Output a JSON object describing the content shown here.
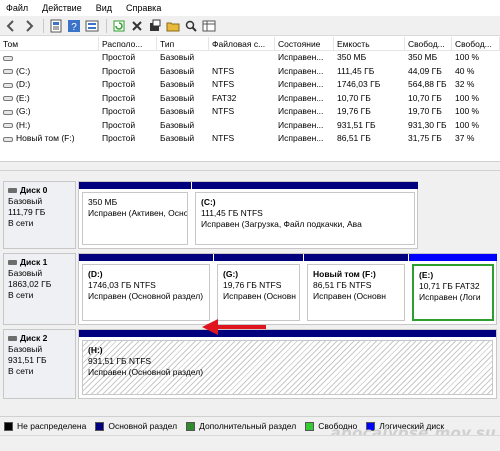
{
  "menu": {
    "file": "Файл",
    "action": "Действие",
    "view": "Вид",
    "help": "Справка"
  },
  "toolbar": {
    "buttons": [
      "back-icon",
      "forward-icon",
      "properties-icon",
      "help-icon",
      "disk-list-icon",
      "refresh-icon",
      "delete-icon",
      "new-icon",
      "open-folder-icon",
      "search-icon",
      "grid-icon"
    ]
  },
  "table": {
    "headers": [
      "Том",
      "Располо...",
      "Тип",
      "Файловая с...",
      "Состояние",
      "Емкость",
      "Свобод...",
      "Свобод..."
    ],
    "rows": [
      {
        "name": "",
        "layout": "Простой",
        "type": "Базовый",
        "fs": "",
        "status": "Исправен...",
        "capacity": "350 МБ",
        "free": "350 МБ",
        "freepct": "100 %"
      },
      {
        "name": "(C:)",
        "layout": "Простой",
        "type": "Базовый",
        "fs": "NTFS",
        "status": "Исправен...",
        "capacity": "111,45 ГБ",
        "free": "44,09 ГБ",
        "freepct": "40 %"
      },
      {
        "name": "(D:)",
        "layout": "Простой",
        "type": "Базовый",
        "fs": "NTFS",
        "status": "Исправен...",
        "capacity": "1746,03 ГБ",
        "free": "564,88 ГБ",
        "freepct": "32 %"
      },
      {
        "name": "(E:)",
        "layout": "Простой",
        "type": "Базовый",
        "fs": "FAT32",
        "status": "Исправен...",
        "capacity": "10,70 ГБ",
        "free": "10,70 ГБ",
        "freepct": "100 %"
      },
      {
        "name": "(G:)",
        "layout": "Простой",
        "type": "Базовый",
        "fs": "NTFS",
        "status": "Исправен...",
        "capacity": "19,76 ГБ",
        "free": "19,70 ГБ",
        "freepct": "100 %"
      },
      {
        "name": "(H:)",
        "layout": "Простой",
        "type": "Базовый",
        "fs": "",
        "status": "Исправен...",
        "capacity": "931,51 ГБ",
        "free": "931,30 ГБ",
        "freepct": "100 %"
      },
      {
        "name": "Новый том (F:)",
        "layout": "Простой",
        "type": "Базовый",
        "fs": "NTFS",
        "status": "Исправен...",
        "capacity": "86,51 ГБ",
        "free": "31,75 ГБ",
        "freepct": "37 %"
      }
    ]
  },
  "disks": [
    {
      "name": "Диск 0",
      "kind": "Базовый",
      "size": "111,79 ГБ",
      "state": "В сети",
      "parts": [
        {
          "title": "",
          "size": "350 МБ",
          "status": "Исправен (Активен, Основ"
        },
        {
          "title": "(C:)",
          "size": "111,45 ГБ NTFS",
          "status": "Исправен (Загрузка, Файл подкачки, Ава"
        }
      ]
    },
    {
      "name": "Диск 1",
      "kind": "Базовый",
      "size": "1863,02 ГБ",
      "state": "В сети",
      "parts": [
        {
          "title": "(D:)",
          "size": "1746,03 ГБ NTFS",
          "status": "Исправен (Основной раздел)"
        },
        {
          "title": "(G:)",
          "size": "19,76 ГБ NTFS",
          "status": "Исправен (Основн"
        },
        {
          "title": "Новый том  (F:)",
          "size": "86,51 ГБ NTFS",
          "status": "Исправен (Основн"
        },
        {
          "title": "(E:)",
          "size": "10,71 ГБ FAT32",
          "status": "Исправен (Логи"
        }
      ]
    },
    {
      "name": "Диск 2",
      "kind": "Базовый",
      "size": "931,51 ГБ",
      "state": "В сети",
      "parts": [
        {
          "title": "(H:)",
          "size": "931,51 ГБ NTFS",
          "status": "Исправен (Основной раздел)"
        }
      ]
    }
  ],
  "legend": [
    {
      "label": "Не распределена",
      "color": "#000000"
    },
    {
      "label": "Основной раздел",
      "color": "#00007f"
    },
    {
      "label": "Дополнительный раздел",
      "color": "#2e8b2e"
    },
    {
      "label": "Свободно",
      "color": "#33cc33"
    },
    {
      "label": "Логический диск",
      "color": "#0000ff"
    }
  ],
  "watermark": "apocalypse.moy.su",
  "colors": {
    "primary": "#00007f",
    "logical": "#0000ff",
    "selected_border": "#2e9e2e",
    "arrow": "#e0141e"
  }
}
